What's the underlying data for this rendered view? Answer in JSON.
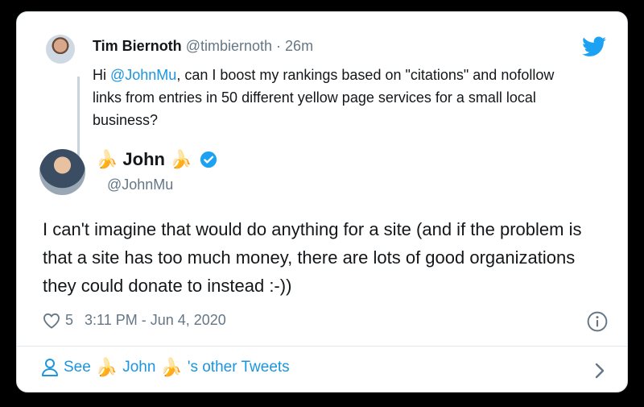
{
  "parent_tweet": {
    "name": "Tim Biernoth",
    "handle": "@timbiernoth",
    "separator": "·",
    "time": "26m",
    "text_prefix": "Hi ",
    "mention": "@JohnMu",
    "text_rest": ", can I boost my rankings based on \"citations\" and nofollow links from entries in 50 different yellow page services for a small local business?"
  },
  "reply": {
    "name_banana_left": "🍌",
    "name": "John",
    "name_banana_right": "🍌",
    "handle": "@JohnMu",
    "text": "I can't imagine that would do anything for a site (and if the problem is that a site has too much money, there are lots of good organizations they could donate to instead :-))",
    "likes": "5",
    "timestamp": "3:11 PM - Jun 4, 2020"
  },
  "footer": {
    "see": "See",
    "banana_left": "🍌",
    "name": "John",
    "banana_right": "🍌",
    "suffix": "'s other Tweets"
  },
  "colors": {
    "link": "#1b95e0",
    "muted": "#657786",
    "text": "#14171a"
  },
  "icons": [
    "twitter-bird-icon",
    "verified-badge-icon",
    "heart-icon",
    "info-icon",
    "person-icon",
    "chevron-right-icon"
  ]
}
